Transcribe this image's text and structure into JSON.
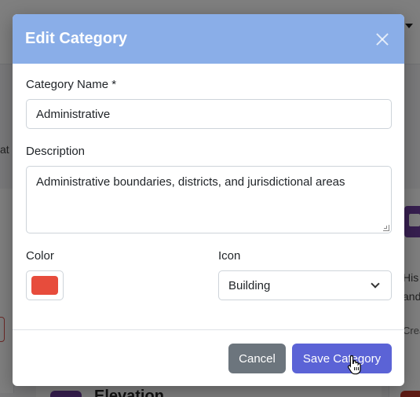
{
  "modal": {
    "title": "Edit Category",
    "close_icon": "close-icon",
    "fields": {
      "name": {
        "label": "Category Name *",
        "value": "Administrative"
      },
      "description": {
        "label": "Description",
        "value": "Administrative boundaries, districts, and jurisdictional areas"
      },
      "color": {
        "label": "Color",
        "value": "#e74c3c"
      },
      "icon": {
        "label": "Icon",
        "selected": "Building"
      }
    },
    "footer": {
      "cancel_label": "Cancel",
      "save_label": "Save Category"
    }
  },
  "background": {
    "left_edge_text": "at",
    "right_edge_text_1": "His",
    "right_edge_text_2": "and",
    "right_edge_text_3": "Crea",
    "bottom_card_title": "Elevation"
  },
  "colors": {
    "header_bg": "#8aaee8",
    "primary_button": "#5b63d6",
    "secondary_button": "#6c757d"
  }
}
